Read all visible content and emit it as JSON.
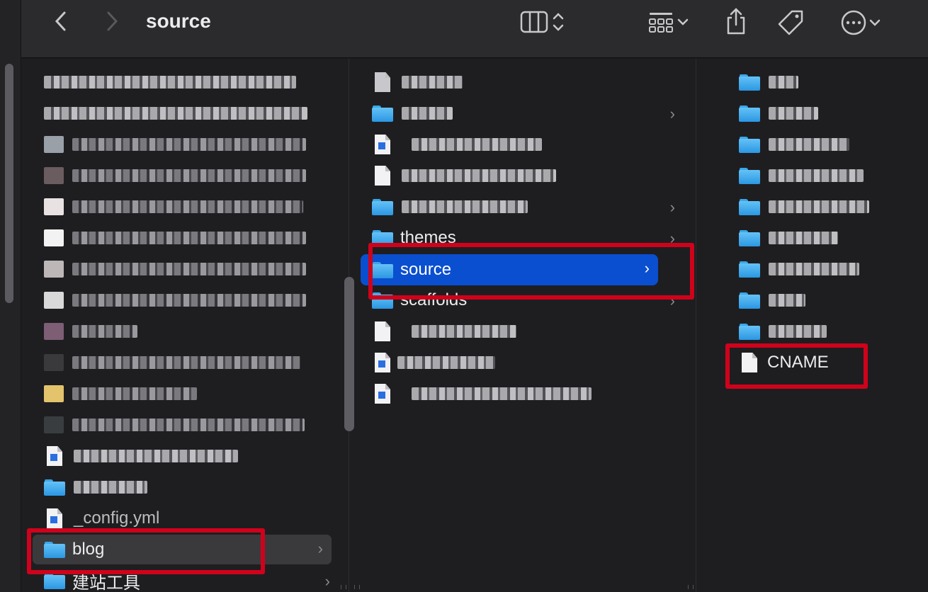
{
  "window": {
    "title": "source"
  },
  "toolbar": {
    "back_icon": "chevron-left-icon",
    "forward_icon": "chevron-right-icon",
    "view_icon": "column-view-icon",
    "group_icon": "grid-group-icon",
    "share_icon": "share-icon",
    "tag_icon": "tag-icon",
    "more_icon": "ellipsis-circle-icon"
  },
  "columns": [
    {
      "items": [
        {
          "type": "blurred",
          "name": ""
        },
        {
          "type": "blurred",
          "name": ""
        },
        {
          "type": "blurred",
          "name": ""
        },
        {
          "type": "blurred",
          "name": ""
        },
        {
          "type": "blurred",
          "name": ""
        },
        {
          "type": "blurred",
          "name": ""
        },
        {
          "type": "blurred",
          "name": ""
        },
        {
          "type": "blurred",
          "name": ""
        },
        {
          "type": "blurred",
          "name": ""
        },
        {
          "type": "blurred",
          "name": ""
        },
        {
          "type": "blurred",
          "name": ""
        },
        {
          "type": "blurred",
          "name": ""
        },
        {
          "type": "blurred",
          "name": ""
        },
        {
          "type": "blurred-folder",
          "name": ""
        },
        {
          "type": "file",
          "name": "_config.yml"
        },
        {
          "type": "folder",
          "name": "blog",
          "selected": true
        },
        {
          "type": "folder",
          "name": "建站工具"
        }
      ]
    },
    {
      "items": [
        {
          "type": "blurred",
          "name": ""
        },
        {
          "type": "blurred-folder",
          "name": ""
        },
        {
          "type": "blurred",
          "name": ""
        },
        {
          "type": "blurred",
          "name": ""
        },
        {
          "type": "blurred-folder",
          "name": ""
        },
        {
          "type": "folder",
          "name": "themes"
        },
        {
          "type": "folder",
          "name": "source",
          "selected": true
        },
        {
          "type": "folder",
          "name": "scaffolds"
        },
        {
          "type": "blurred",
          "name": ""
        },
        {
          "type": "blurred",
          "name": ""
        },
        {
          "type": "blurred",
          "name": ""
        }
      ]
    },
    {
      "items": [
        {
          "type": "blurred-folder",
          "name": ""
        },
        {
          "type": "blurred-folder",
          "name": ""
        },
        {
          "type": "blurred-folder",
          "name": ""
        },
        {
          "type": "blurred-folder",
          "name": ""
        },
        {
          "type": "blurred-folder",
          "name": ""
        },
        {
          "type": "blurred-folder",
          "name": ""
        },
        {
          "type": "blurred-folder",
          "name": ""
        },
        {
          "type": "blurred-folder",
          "name": ""
        },
        {
          "type": "blurred-folder",
          "name": ""
        },
        {
          "type": "file",
          "name": "CNAME"
        }
      ]
    }
  ],
  "labels": {
    "config": "_config.yml",
    "blog": "blog",
    "tools": "建站工具",
    "themes": "themes",
    "source": "source",
    "scaffolds": "scaffolds",
    "cname": "CNAME"
  },
  "colors": {
    "highlight": "#0a4fd0",
    "annotation": "#d0021b",
    "folder": "#3aa7ea"
  }
}
